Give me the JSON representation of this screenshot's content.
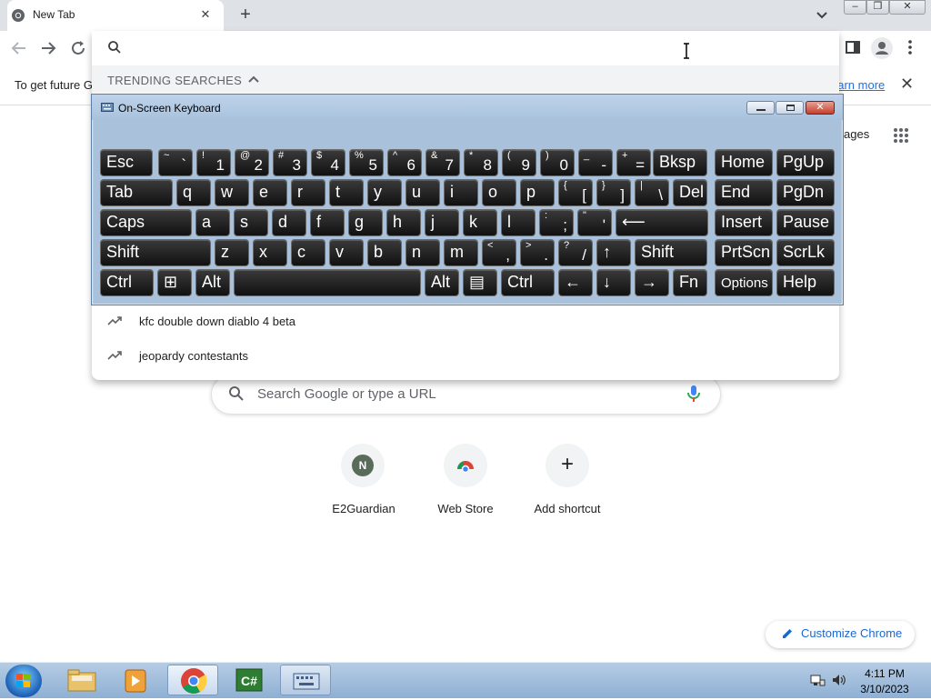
{
  "tab": {
    "title": "New Tab",
    "close": "✕",
    "new_tab": "+"
  },
  "window_controls": {
    "minimize": "–",
    "restore": "❐",
    "close": "✕"
  },
  "infobar": {
    "text": "To get future G",
    "link": "earn more",
    "close": "✕"
  },
  "omnibox": {
    "value": "",
    "trending_label": "TRENDING SEARCHES",
    "suggestions": [
      "kfc double down diablo 4 beta",
      "jeopardy contestants"
    ]
  },
  "page": {
    "apps_label": "ages",
    "search_placeholder": "Search Google or type a URL",
    "shortcuts": [
      {
        "label": "E2Guardian",
        "initial": "N"
      },
      {
        "label": "Web Store",
        "initial": ""
      },
      {
        "label": "Add shortcut",
        "initial": "+"
      }
    ],
    "customize_label": "Customize Chrome"
  },
  "osk": {
    "title": "On-Screen Keyboard",
    "rows": [
      [
        {
          "m": "Esc"
        },
        {
          "s": "~",
          "b": "`"
        },
        {
          "s": "!",
          "b": "1"
        },
        {
          "s": "@",
          "b": "2"
        },
        {
          "s": "#",
          "b": "3"
        },
        {
          "s": "$",
          "b": "4"
        },
        {
          "s": "%",
          "b": "5"
        },
        {
          "s": "^",
          "b": "6"
        },
        {
          "s": "&",
          "b": "7"
        },
        {
          "s": "*",
          "b": "8"
        },
        {
          "s": "(",
          "b": "9"
        },
        {
          "s": ")",
          "b": "0"
        },
        {
          "s": "_",
          "b": "-"
        },
        {
          "s": "+",
          "b": "="
        },
        {
          "m": "Bksp"
        },
        {
          "m": "Home"
        },
        {
          "m": "PgUp"
        }
      ],
      [
        {
          "m": "Tab"
        },
        {
          "m": "q"
        },
        {
          "m": "w"
        },
        {
          "m": "e"
        },
        {
          "m": "r"
        },
        {
          "m": "t"
        },
        {
          "m": "y"
        },
        {
          "m": "u"
        },
        {
          "m": "i"
        },
        {
          "m": "o"
        },
        {
          "m": "p"
        },
        {
          "s": "{",
          "b": "["
        },
        {
          "s": "}",
          "b": "]"
        },
        {
          "s": "|",
          "b": "\\"
        },
        {
          "m": "Del"
        },
        {
          "m": "End"
        },
        {
          "m": "PgDn"
        }
      ],
      [
        {
          "m": "Caps"
        },
        {
          "m": "a"
        },
        {
          "m": "s"
        },
        {
          "m": "d"
        },
        {
          "m": "f"
        },
        {
          "m": "g"
        },
        {
          "m": "h"
        },
        {
          "m": "j"
        },
        {
          "m": "k"
        },
        {
          "m": "l"
        },
        {
          "s": ":",
          "b": ";"
        },
        {
          "s": "\"",
          "b": "'"
        },
        {
          "m": "⟵"
        },
        {
          "m": "Insert"
        },
        {
          "m": "Pause"
        }
      ],
      [
        {
          "m": "Shift"
        },
        {
          "m": "z"
        },
        {
          "m": "x"
        },
        {
          "m": "c"
        },
        {
          "m": "v"
        },
        {
          "m": "b"
        },
        {
          "m": "n"
        },
        {
          "m": "m"
        },
        {
          "s": "<",
          "b": ","
        },
        {
          "s": ">",
          "b": "."
        },
        {
          "s": "?",
          "b": "/"
        },
        {
          "m": "↑"
        },
        {
          "m": "Shift"
        },
        {
          "m": "PrtScn"
        },
        {
          "m": "ScrLk"
        }
      ],
      [
        {
          "m": "Ctrl"
        },
        {
          "m": "⊞"
        },
        {
          "m": "Alt"
        },
        {
          "m": ""
        },
        {
          "m": "Alt"
        },
        {
          "m": "▤"
        },
        {
          "m": "Ctrl"
        },
        {
          "m": "←"
        },
        {
          "m": "↓"
        },
        {
          "m": "→"
        },
        {
          "m": "Fn"
        },
        {
          "m": "Options"
        },
        {
          "m": "Help"
        }
      ]
    ]
  },
  "taskbar": {
    "apps": [
      "explorer-icon",
      "media-player-icon",
      "chrome-icon",
      "csharp-icon",
      "keyboard-icon"
    ],
    "time": "4:11 PM",
    "date": "3/10/2023"
  },
  "colors": {
    "accent": "#1a73e8",
    "keycap": "#111111",
    "osk_frame": "#b3cbe2"
  }
}
